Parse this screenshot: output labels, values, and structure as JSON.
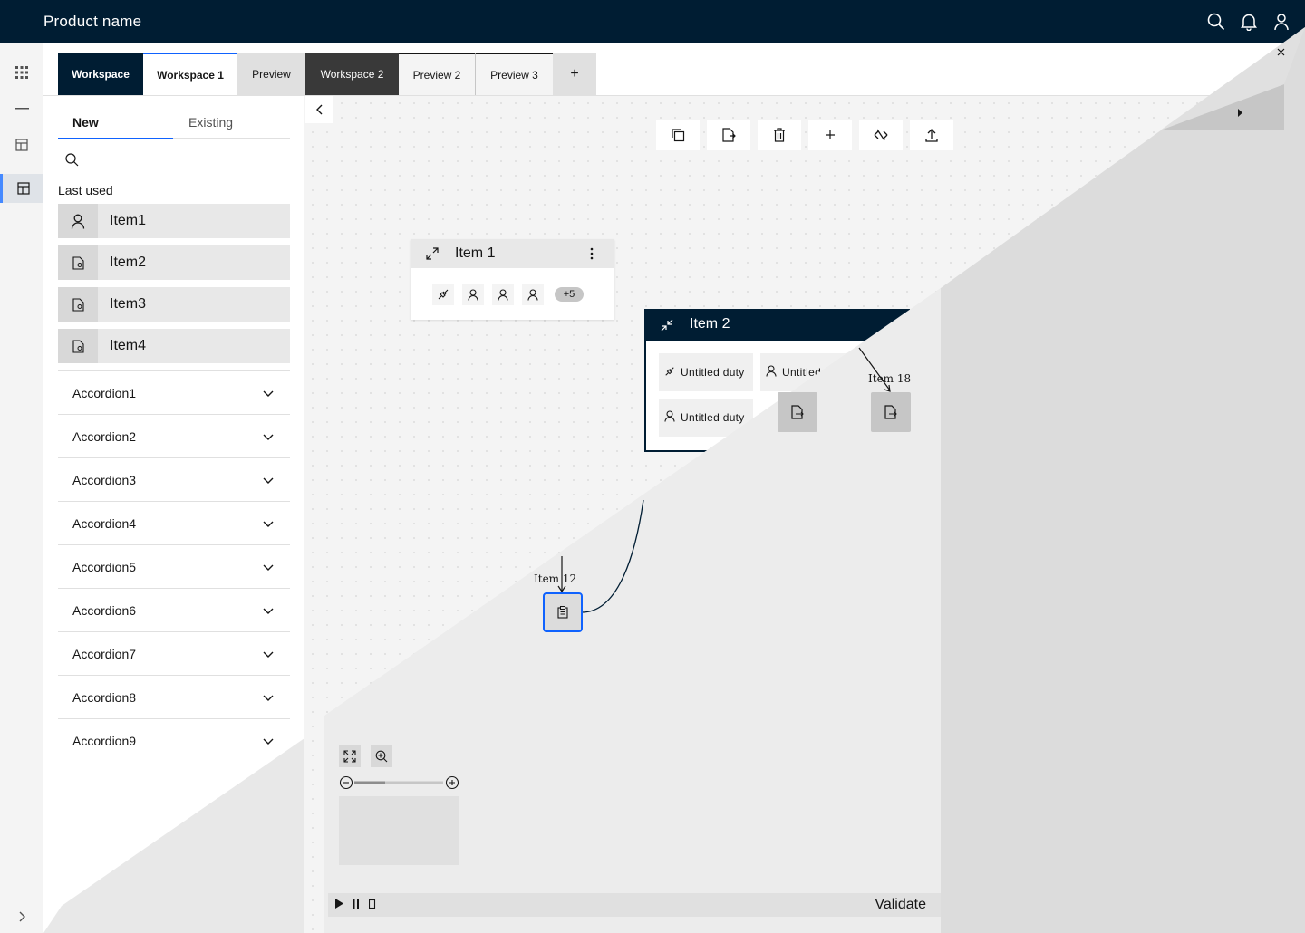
{
  "header": {
    "title": "Product name",
    "icons": [
      "search-icon",
      "notification-icon",
      "user-icon"
    ]
  },
  "rail": {
    "icons": [
      "app-grid-icon",
      "divider-icon",
      "template-icon",
      "template-active-icon",
      "chevron-right-icon"
    ]
  },
  "workspace_tabs": [
    {
      "label": "Workspace"
    },
    {
      "label": "Workspace 1"
    },
    {
      "label": "Preview"
    },
    {
      "label": "Workspace 2"
    },
    {
      "label": "Preview 2"
    },
    {
      "label": "Preview 3"
    },
    {
      "label": "+"
    }
  ],
  "panel": {
    "tabs": [
      {
        "label": "New"
      },
      {
        "label": "Existing"
      }
    ],
    "search_placeholder": "",
    "last_used_label": "Last used",
    "items": [
      {
        "label": "Item1",
        "icon": "user-icon"
      },
      {
        "label": "Item2",
        "icon": "document-icon"
      },
      {
        "label": "Item3",
        "icon": "document-icon"
      },
      {
        "label": "Item4",
        "icon": "document-icon"
      }
    ],
    "accordions": [
      {
        "label": "Accordion1"
      },
      {
        "label": "Accordion2"
      },
      {
        "label": "Accordion3"
      },
      {
        "label": "Accordion4"
      },
      {
        "label": "Accordion5"
      },
      {
        "label": "Accordion6"
      },
      {
        "label": "Accordion7"
      },
      {
        "label": "Accordion8"
      },
      {
        "label": "Accordion9"
      }
    ]
  },
  "toolbar": {
    "icons": [
      "copy-icon",
      "document-import-icon",
      "trash-icon",
      "add-icon",
      "unlink-icon",
      "upload-icon"
    ]
  },
  "node1": {
    "title": "Item 1",
    "overflow_badge": "+5"
  },
  "node2": {
    "title": "Item 2",
    "duties": [
      {
        "label": "Untitled duty"
      },
      {
        "label": "Untitled"
      },
      {
        "label": "Untitled duty"
      }
    ]
  },
  "edge_labels": {
    "item12": "Item 12",
    "item18": "Item 18"
  },
  "bottom": {
    "validate_label": "Validate"
  },
  "colors": {
    "header": "#001d33",
    "accent": "#0f62fe",
    "canvas": "#f4f4f4"
  }
}
